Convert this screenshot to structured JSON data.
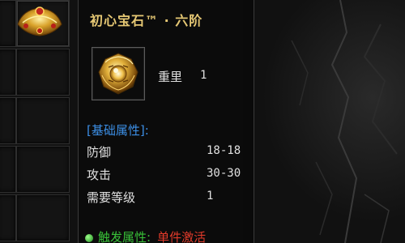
{
  "tooltip": {
    "title": "初心宝石™ · 六阶",
    "icon": "gold-gem-icon",
    "weight_label": "重里",
    "weight_value": "1",
    "base_section_label": "[基础属性]:",
    "stats": [
      {
        "name": "防御",
        "value": "18-18"
      },
      {
        "name": "攻击",
        "value": "30-30"
      },
      {
        "name": "需要等级",
        "value": "1"
      }
    ],
    "trigger_label": "触发属性:",
    "trigger_value": "单件激活"
  },
  "colors": {
    "title": "#e6c874",
    "section": "#3c8fe6",
    "trigger_label": "#38c038",
    "trigger_value": "#e03a2a"
  },
  "inventory": {
    "item_icon": "gold-ornament-icon"
  }
}
